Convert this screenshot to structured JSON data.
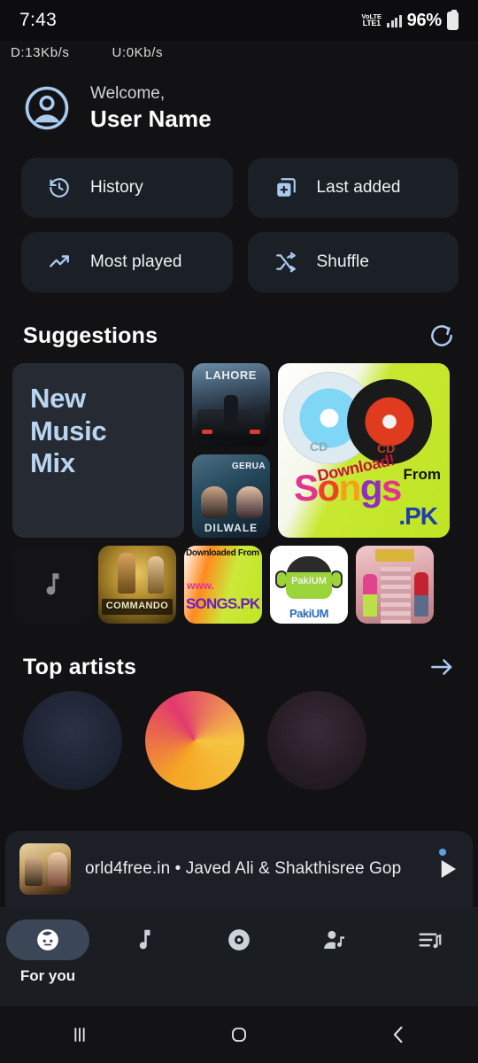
{
  "status_bar": {
    "time": "7:43",
    "network_type": "VoLTE",
    "network_slot": "LTE1",
    "battery_percent": "96%",
    "download_speed": "D:13Kb/s",
    "upload_speed": "U:0Kb/s"
  },
  "header": {
    "greeting": "Welcome,",
    "user_name": "User Name"
  },
  "quick_actions": [
    {
      "label": "History",
      "icon": "history-icon"
    },
    {
      "label": "Last added",
      "icon": "library-add-icon"
    },
    {
      "label": "Most played",
      "icon": "trending-up-icon"
    },
    {
      "label": "Shuffle",
      "icon": "shuffle-icon"
    }
  ],
  "suggestions": {
    "title": "Suggestions",
    "refresh_icon": "refresh-icon",
    "mix_card": {
      "line1": "New",
      "line2": "Music",
      "line3": "Mix"
    },
    "tiles": [
      {
        "name": "Lahore",
        "title": "LAHORE"
      },
      {
        "name": "Gerua Dilwale",
        "title": "GERUA",
        "subtitle": "DILWALE"
      },
      {
        "name": "Songs.PK",
        "cd_label_1": "CD",
        "cd_label_2": "CD",
        "download": "Download!",
        "from": "From",
        "brand": "Songs",
        "domain": ".PK"
      },
      {
        "name": "Unknown album",
        "title": ""
      },
      {
        "name": "Commando",
        "title": "COMMANDO"
      },
      {
        "name": "Songs.PK download",
        "l1": "Downloaded From",
        "l2": "www.",
        "l3": "SONGS.PK"
      },
      {
        "name": "PakiUM",
        "txt": "PakiUM",
        "bottom": "PakiUM"
      },
      {
        "name": "Bollywood couple",
        "title": ""
      }
    ]
  },
  "top_artists": {
    "title": "Top artists",
    "arrow_icon": "arrow-right-icon"
  },
  "now_playing": {
    "title": "orld4free.in • Javed Ali & Shakthisree Gop",
    "play_icon": "play-icon",
    "accent_color": "#5e9fe0"
  },
  "bottom_nav": [
    {
      "label": "For you",
      "icon": "face-icon",
      "active": true
    },
    {
      "label": "Songs",
      "icon": "music-note-icon",
      "active": false
    },
    {
      "label": "Albums",
      "icon": "disc-icon",
      "active": false
    },
    {
      "label": "Artists",
      "icon": "artist-icon",
      "active": false
    },
    {
      "label": "Playlists",
      "icon": "playlist-icon",
      "active": false
    }
  ],
  "android_nav": [
    {
      "label": "Recents",
      "icon": "recents-icon"
    },
    {
      "label": "Home",
      "icon": "home-icon"
    },
    {
      "label": "Back",
      "icon": "back-icon"
    }
  ],
  "colors": {
    "background": "#121214",
    "card": "#1b1f26",
    "accent_blue": "#a9cbf0",
    "mix_card_bg": "#262b33"
  }
}
